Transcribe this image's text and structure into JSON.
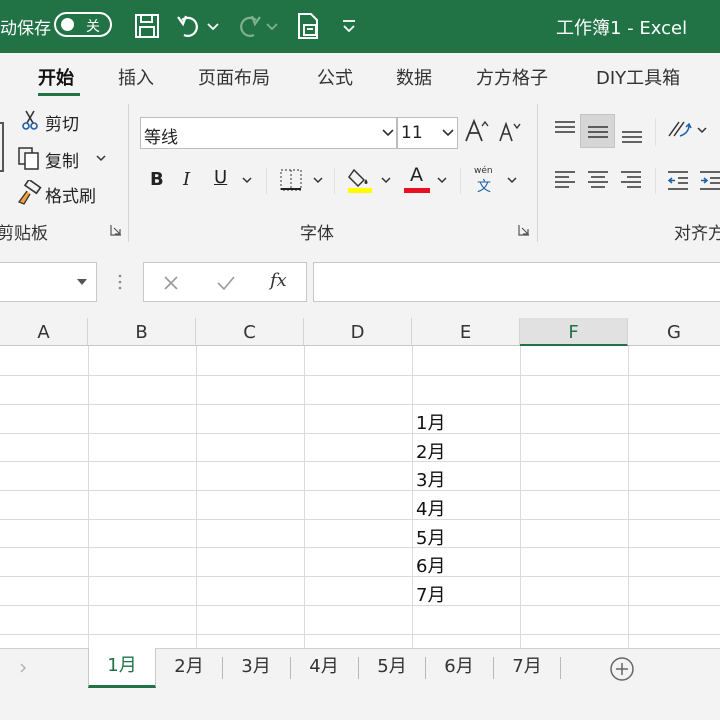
{
  "titlebar": {
    "autosave_label": "动保存",
    "toggle_label": "关",
    "window_title": "工作簿1  -  Excel",
    "icons": [
      "save-icon",
      "undo-icon",
      "redo-icon",
      "print-preview-icon",
      "customize-qat-icon"
    ]
  },
  "tabs": [
    {
      "label": "开始",
      "active": true
    },
    {
      "label": "插入"
    },
    {
      "label": "页面布局"
    },
    {
      "label": "公式"
    },
    {
      "label": "数据"
    },
    {
      "label": "方方格子"
    },
    {
      "label": "DIY工具箱"
    }
  ],
  "ribbon": {
    "clipboard": {
      "cut": "剪切",
      "copy": "复制",
      "format_painter": "格式刷",
      "group_label": "剪贴板"
    },
    "font": {
      "font_name": "等线",
      "font_size": "11",
      "bold": "B",
      "italic": "I",
      "underline": "U",
      "font_color_letter": "A",
      "phonetic_top": "wén",
      "phonetic_bottom": "文",
      "group_label": "字体",
      "fill_color": "#ffff00",
      "font_color": "#e81123"
    },
    "alignment": {
      "group_label": "对齐方"
    }
  },
  "formula_bar": {
    "name_box": "",
    "formula": "",
    "fx": "fx"
  },
  "grid": {
    "columns": [
      "A",
      "B",
      "C",
      "D",
      "E",
      "F",
      "G"
    ],
    "selected_column": "F",
    "cells_E": [
      "1月",
      "2月",
      "3月",
      "4月",
      "5月",
      "6月",
      "7月"
    ]
  },
  "sheets": {
    "tabs": [
      "1月",
      "2月",
      "3月",
      "4月",
      "5月",
      "6月",
      "7月"
    ],
    "active": "1月"
  },
  "colors": {
    "accent": "#217346"
  }
}
